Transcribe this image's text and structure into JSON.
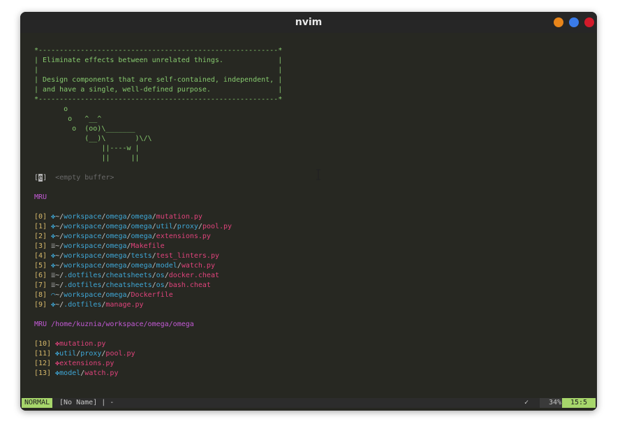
{
  "window": {
    "title": "nvim"
  },
  "quote": {
    "border": "*---------------------------------------------------------*",
    "lines": [
      "| Eliminate effects between unrelated things.             |",
      "|                                                         |",
      "| Design components that are self-contained, independent, |",
      "| and have a single, well-defined purpose.                |"
    ]
  },
  "cow": [
    "       o",
    "        o   ^__^",
    "         o  (oo)\\_______",
    "            (__)\\       )\\/\\",
    "                ||----w |",
    "                ||     ||"
  ],
  "empty_entry": {
    "key": "e",
    "label": "<empty buffer>"
  },
  "mru_header": "MRU",
  "mru_items": [
    {
      "idx": "[0]",
      "icon": "python-icon",
      "glyph": "✤",
      "prefix": "~/",
      "parts": [
        "workspace",
        "omega",
        "omega"
      ],
      "file": "mutation.py"
    },
    {
      "idx": "[1]",
      "icon": "python-icon",
      "glyph": "✤",
      "prefix": "~/",
      "parts": [
        "workspace",
        "omega",
        "omega",
        "util",
        "proxy"
      ],
      "file": "pool.py"
    },
    {
      "idx": "[2]",
      "icon": "python-icon",
      "glyph": "✤",
      "prefix": "~/",
      "parts": [
        "workspace",
        "omega",
        "omega"
      ],
      "file": "extensions.py"
    },
    {
      "idx": "[3]",
      "icon": "text-file-icon",
      "glyph": "≣",
      "prefix": "~/",
      "parts": [
        "workspace",
        "omega"
      ],
      "file": "Makefile"
    },
    {
      "idx": "[4]",
      "icon": "python-icon",
      "glyph": "✤",
      "prefix": "~/",
      "parts": [
        "workspace",
        "omega",
        "tests"
      ],
      "file": "test_linters.py"
    },
    {
      "idx": "[5]",
      "icon": "python-icon",
      "glyph": "✤",
      "prefix": "~/",
      "parts": [
        "workspace",
        "omega",
        "omega",
        "model"
      ],
      "file": "watch.py"
    },
    {
      "idx": "[6]",
      "icon": "text-file-icon",
      "glyph": "≣",
      "prefix": "~/",
      "parts": [
        ".dotfiles",
        "cheatsheets",
        "os"
      ],
      "file": "docker.cheat"
    },
    {
      "idx": "[7]",
      "icon": "text-file-icon",
      "glyph": "≣",
      "prefix": "~/",
      "parts": [
        ".dotfiles",
        "cheatsheets",
        "os"
      ],
      "file": "bash.cheat"
    },
    {
      "idx": "[8]",
      "icon": "docker-icon",
      "glyph": "⌒",
      "prefix": "~/",
      "parts": [
        "workspace",
        "omega"
      ],
      "file": "Dockerfile"
    },
    {
      "idx": "[9]",
      "icon": "python-icon",
      "glyph": "✤",
      "prefix": "~/",
      "parts": [
        ".dotfiles"
      ],
      "file": "manage.py"
    }
  ],
  "mru_dir_header": "MRU /home/kuznia/workspace/omega/omega",
  "mru_dir_items": [
    {
      "idx": "[10]",
      "icon": "python-icon-red",
      "glyph": "✤",
      "parts": [],
      "file": "mutation.py"
    },
    {
      "idx": "[11]",
      "icon": "python-icon",
      "glyph": "✤",
      "parts": [
        "util",
        "proxy"
      ],
      "file": "pool.py"
    },
    {
      "idx": "[12]",
      "icon": "python-icon-red",
      "glyph": "✤",
      "parts": [],
      "file": "extensions.py"
    },
    {
      "idx": "[13]",
      "icon": "python-icon",
      "glyph": "✤",
      "parts": [
        "model"
      ],
      "file": "watch.py"
    }
  ],
  "statusline": {
    "mode": "NORMAL",
    "file": "[No Name] | -",
    "check": "✓",
    "percent": "34%",
    "position": "15:5"
  },
  "colors": {
    "background": "#272822",
    "mode_bg": "#a7d66b",
    "dir": "#3fa8d8",
    "file": "#e0437c",
    "header": "#c35ad5",
    "quote": "#86c96e"
  }
}
